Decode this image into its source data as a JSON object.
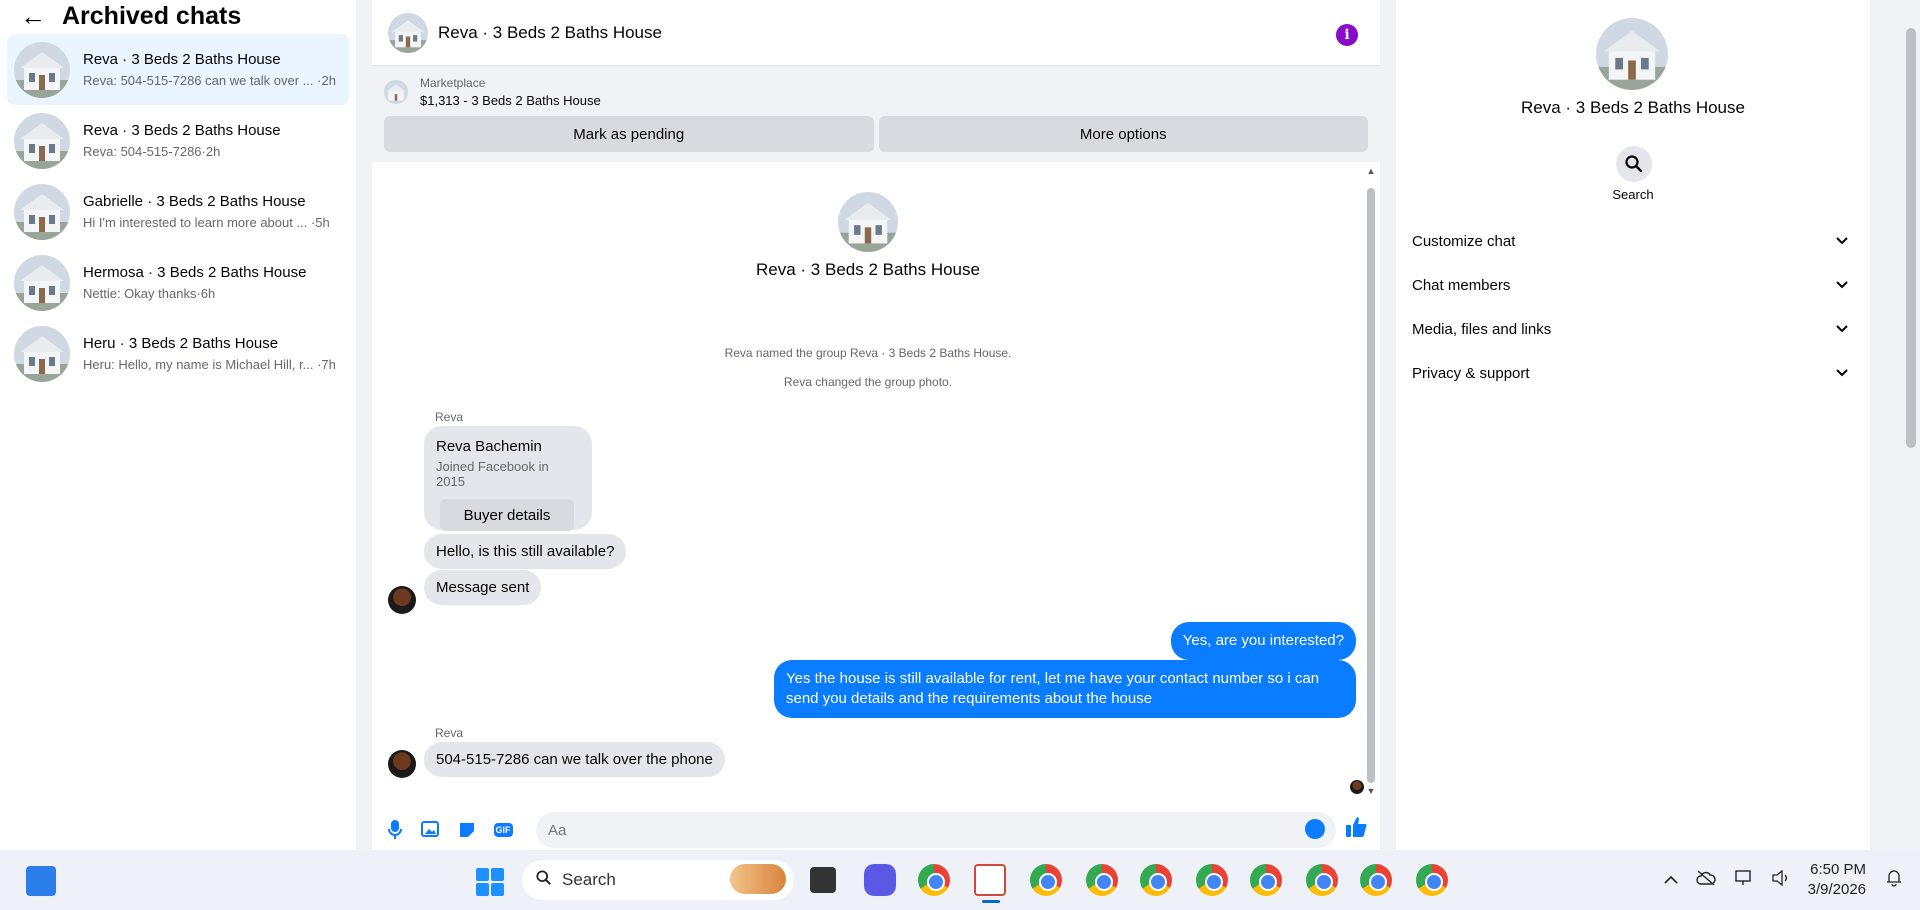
{
  "sidebar": {
    "title": "Archived chats",
    "chats": [
      {
        "name": "Reva · 3 Beds 2 Baths House",
        "preview": "Reva: 504-515-7286 can we talk over ... ·2h"
      },
      {
        "name": "Reva · 3 Beds 2 Baths House",
        "preview": "Reva: 504-515-7286·2h"
      },
      {
        "name": "Gabrielle · 3 Beds 2 Baths House",
        "preview": "Hi I'm interested to learn more about ... ·5h"
      },
      {
        "name": "Hermosa · 3 Beds 2 Baths House",
        "preview": "Nettie: Okay thanks·6h"
      },
      {
        "name": "Heru · 3 Beds 2 Baths House",
        "preview": "Heru: Hello, my name is Michael Hill, r... ·7h"
      }
    ]
  },
  "conversation": {
    "title": "Reva · 3 Beds 2 Baths House",
    "info_glyph": "i",
    "marketplace": {
      "label": "Marketplace",
      "listing": "$1,313 - 3 Beds 2 Baths House",
      "pending_button": "Mark as pending",
      "more_button": "More options"
    },
    "group_title": "Reva · 3 Beds 2 Baths House",
    "system_messages": [
      "Reva named the group Reva · 3 Beds 2 Baths House.",
      "Reva changed the group photo."
    ],
    "sender": "Reva",
    "buyer_card": {
      "name": "Reva Bachemin",
      "subtitle": "Joined Facebook in 2015",
      "button": "Buyer details"
    },
    "incoming_1": "Hello, is this still available?",
    "incoming_2": "Message sent",
    "outgoing_1": "Yes, are you interested?",
    "outgoing_2": "Yes the house is still available for rent, let me have your contact number so i can send you details and the requirements about the house",
    "sender_2": "Reva",
    "incoming_3": "504-515-7286  can we talk over the phone",
    "composer_placeholder": "Aa",
    "gif_label": "GIF"
  },
  "info_panel": {
    "title": "Reva · 3 Beds 2 Baths House",
    "search_label": "Search",
    "sections": [
      "Customize chat",
      "Chat members",
      "Media, files and links",
      "Privacy & support"
    ]
  },
  "taskbar": {
    "search_label": "Search",
    "time": "6:50 PM",
    "date": "3/9/2026"
  },
  "colors": {
    "accent": "#0a7cff",
    "info": "#8a0aca",
    "active_chat": "#ebf5ff"
  }
}
